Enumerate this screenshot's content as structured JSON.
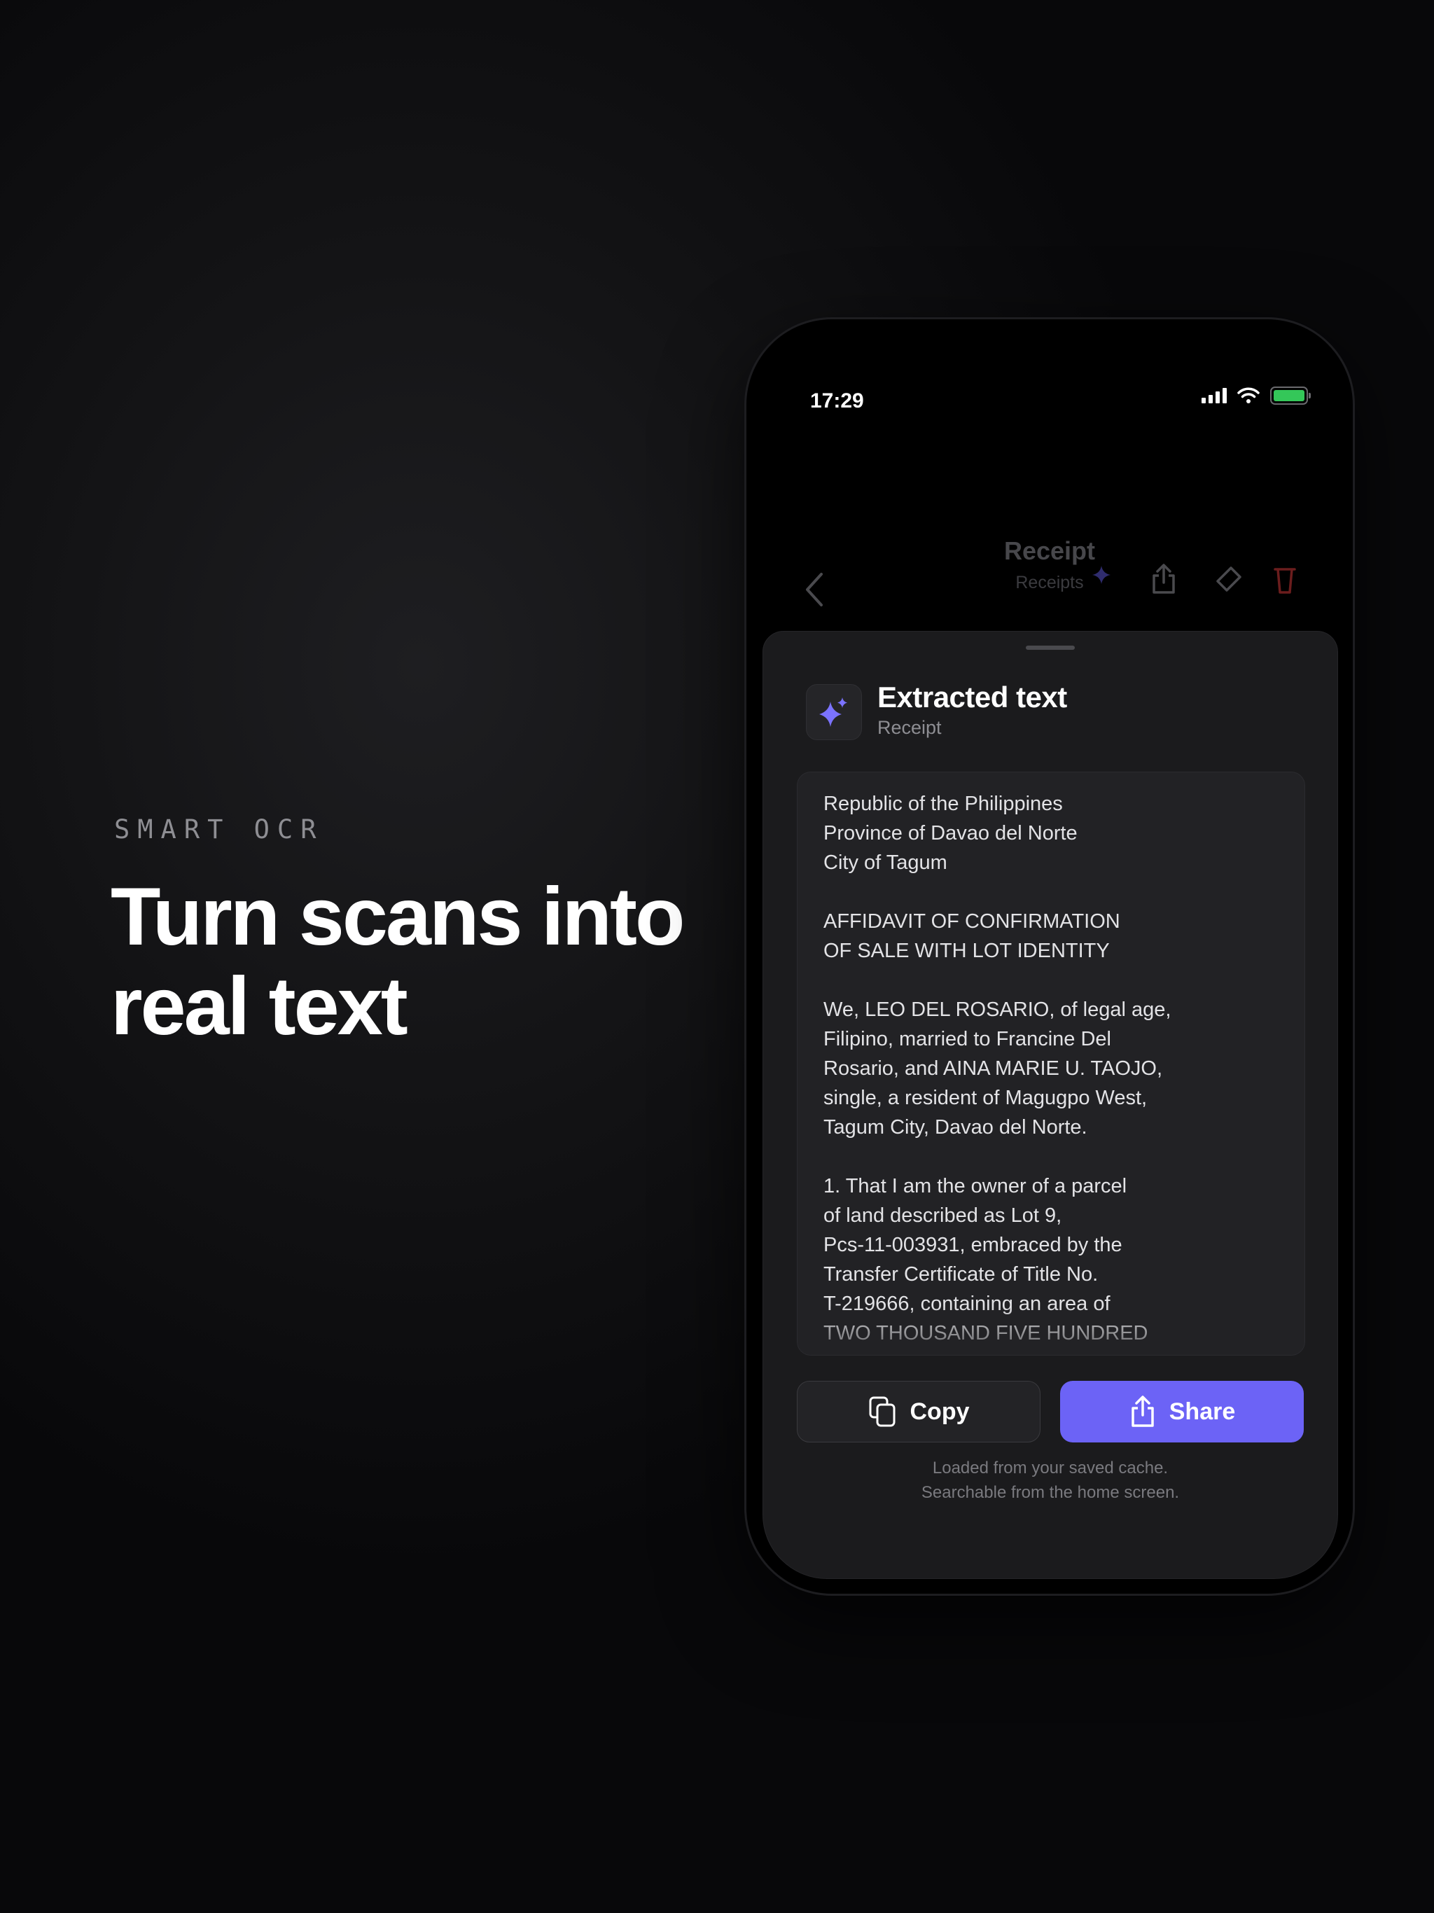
{
  "marketing": {
    "kicker": "SMART OCR",
    "headline_line1": "Turn scans into",
    "headline_line2": "real text"
  },
  "status_bar": {
    "time": "17:29",
    "battery_color": "#34c759"
  },
  "nav": {
    "title": "Receipt",
    "subtitle": "Receipts",
    "icons": [
      "chevron-left-icon",
      "sparkle-icon",
      "share-icon",
      "tag-icon",
      "trash-icon"
    ]
  },
  "sheet": {
    "title": "Extracted text",
    "subtitle": "Receipt",
    "icon": "sparkle-icon",
    "accent_color": "#6c63f6",
    "lines": [
      "Republic of the Philippines",
      "Province of Davao del Norte",
      "City of Tagum",
      "",
      "AFFIDAVIT OF CONFIRMATION",
      "OF SALE WITH LOT IDENTITY",
      "",
      "We, LEO DEL ROSARIO, of legal age,",
      "Filipino, married to Francine Del",
      "Rosario, and AINA MARIE U. TAOJO,",
      "single, a resident of Magugpo West,",
      "Tagum City, Davao del Norte.",
      "",
      "1. That I am the owner of a parcel",
      "of land described as Lot 9,",
      "Pcs-11-003931, embraced by the",
      "Transfer Certificate of Title No.",
      "T-219666, containing an area of",
      "TWO THOUSAND FIVE HUNDRED"
    ],
    "copy_label": "Copy",
    "share_label": "Share",
    "footnote_line1": "Loaded from your saved cache.",
    "footnote_line2": "Searchable from the home screen."
  }
}
